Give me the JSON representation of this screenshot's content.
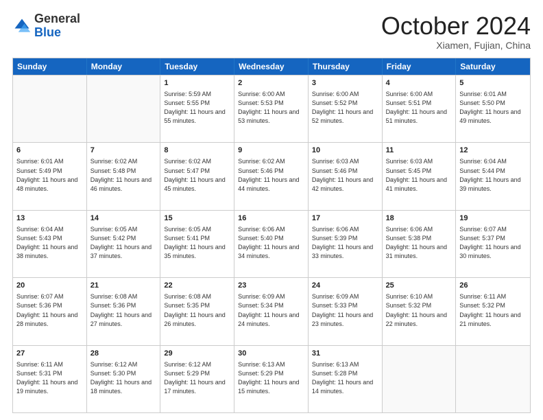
{
  "header": {
    "logo": {
      "general": "General",
      "blue": "Blue"
    },
    "title": "October 2024",
    "location": "Xiamen, Fujian, China"
  },
  "weekdays": [
    "Sunday",
    "Monday",
    "Tuesday",
    "Wednesday",
    "Thursday",
    "Friday",
    "Saturday"
  ],
  "rows": [
    [
      {
        "day": "",
        "sunrise": "",
        "sunset": "",
        "daylight": ""
      },
      {
        "day": "",
        "sunrise": "",
        "sunset": "",
        "daylight": ""
      },
      {
        "day": "1",
        "sunrise": "Sunrise: 5:59 AM",
        "sunset": "Sunset: 5:55 PM",
        "daylight": "Daylight: 11 hours and 55 minutes."
      },
      {
        "day": "2",
        "sunrise": "Sunrise: 6:00 AM",
        "sunset": "Sunset: 5:53 PM",
        "daylight": "Daylight: 11 hours and 53 minutes."
      },
      {
        "day": "3",
        "sunrise": "Sunrise: 6:00 AM",
        "sunset": "Sunset: 5:52 PM",
        "daylight": "Daylight: 11 hours and 52 minutes."
      },
      {
        "day": "4",
        "sunrise": "Sunrise: 6:00 AM",
        "sunset": "Sunset: 5:51 PM",
        "daylight": "Daylight: 11 hours and 51 minutes."
      },
      {
        "day": "5",
        "sunrise": "Sunrise: 6:01 AM",
        "sunset": "Sunset: 5:50 PM",
        "daylight": "Daylight: 11 hours and 49 minutes."
      }
    ],
    [
      {
        "day": "6",
        "sunrise": "Sunrise: 6:01 AM",
        "sunset": "Sunset: 5:49 PM",
        "daylight": "Daylight: 11 hours and 48 minutes."
      },
      {
        "day": "7",
        "sunrise": "Sunrise: 6:02 AM",
        "sunset": "Sunset: 5:48 PM",
        "daylight": "Daylight: 11 hours and 46 minutes."
      },
      {
        "day": "8",
        "sunrise": "Sunrise: 6:02 AM",
        "sunset": "Sunset: 5:47 PM",
        "daylight": "Daylight: 11 hours and 45 minutes."
      },
      {
        "day": "9",
        "sunrise": "Sunrise: 6:02 AM",
        "sunset": "Sunset: 5:46 PM",
        "daylight": "Daylight: 11 hours and 44 minutes."
      },
      {
        "day": "10",
        "sunrise": "Sunrise: 6:03 AM",
        "sunset": "Sunset: 5:46 PM",
        "daylight": "Daylight: 11 hours and 42 minutes."
      },
      {
        "day": "11",
        "sunrise": "Sunrise: 6:03 AM",
        "sunset": "Sunset: 5:45 PM",
        "daylight": "Daylight: 11 hours and 41 minutes."
      },
      {
        "day": "12",
        "sunrise": "Sunrise: 6:04 AM",
        "sunset": "Sunset: 5:44 PM",
        "daylight": "Daylight: 11 hours and 39 minutes."
      }
    ],
    [
      {
        "day": "13",
        "sunrise": "Sunrise: 6:04 AM",
        "sunset": "Sunset: 5:43 PM",
        "daylight": "Daylight: 11 hours and 38 minutes."
      },
      {
        "day": "14",
        "sunrise": "Sunrise: 6:05 AM",
        "sunset": "Sunset: 5:42 PM",
        "daylight": "Daylight: 11 hours and 37 minutes."
      },
      {
        "day": "15",
        "sunrise": "Sunrise: 6:05 AM",
        "sunset": "Sunset: 5:41 PM",
        "daylight": "Daylight: 11 hours and 35 minutes."
      },
      {
        "day": "16",
        "sunrise": "Sunrise: 6:06 AM",
        "sunset": "Sunset: 5:40 PM",
        "daylight": "Daylight: 11 hours and 34 minutes."
      },
      {
        "day": "17",
        "sunrise": "Sunrise: 6:06 AM",
        "sunset": "Sunset: 5:39 PM",
        "daylight": "Daylight: 11 hours and 33 minutes."
      },
      {
        "day": "18",
        "sunrise": "Sunrise: 6:06 AM",
        "sunset": "Sunset: 5:38 PM",
        "daylight": "Daylight: 11 hours and 31 minutes."
      },
      {
        "day": "19",
        "sunrise": "Sunrise: 6:07 AM",
        "sunset": "Sunset: 5:37 PM",
        "daylight": "Daylight: 11 hours and 30 minutes."
      }
    ],
    [
      {
        "day": "20",
        "sunrise": "Sunrise: 6:07 AM",
        "sunset": "Sunset: 5:36 PM",
        "daylight": "Daylight: 11 hours and 28 minutes."
      },
      {
        "day": "21",
        "sunrise": "Sunrise: 6:08 AM",
        "sunset": "Sunset: 5:36 PM",
        "daylight": "Daylight: 11 hours and 27 minutes."
      },
      {
        "day": "22",
        "sunrise": "Sunrise: 6:08 AM",
        "sunset": "Sunset: 5:35 PM",
        "daylight": "Daylight: 11 hours and 26 minutes."
      },
      {
        "day": "23",
        "sunrise": "Sunrise: 6:09 AM",
        "sunset": "Sunset: 5:34 PM",
        "daylight": "Daylight: 11 hours and 24 minutes."
      },
      {
        "day": "24",
        "sunrise": "Sunrise: 6:09 AM",
        "sunset": "Sunset: 5:33 PM",
        "daylight": "Daylight: 11 hours and 23 minutes."
      },
      {
        "day": "25",
        "sunrise": "Sunrise: 6:10 AM",
        "sunset": "Sunset: 5:32 PM",
        "daylight": "Daylight: 11 hours and 22 minutes."
      },
      {
        "day": "26",
        "sunrise": "Sunrise: 6:11 AM",
        "sunset": "Sunset: 5:32 PM",
        "daylight": "Daylight: 11 hours and 21 minutes."
      }
    ],
    [
      {
        "day": "27",
        "sunrise": "Sunrise: 6:11 AM",
        "sunset": "Sunset: 5:31 PM",
        "daylight": "Daylight: 11 hours and 19 minutes."
      },
      {
        "day": "28",
        "sunrise": "Sunrise: 6:12 AM",
        "sunset": "Sunset: 5:30 PM",
        "daylight": "Daylight: 11 hours and 18 minutes."
      },
      {
        "day": "29",
        "sunrise": "Sunrise: 6:12 AM",
        "sunset": "Sunset: 5:29 PM",
        "daylight": "Daylight: 11 hours and 17 minutes."
      },
      {
        "day": "30",
        "sunrise": "Sunrise: 6:13 AM",
        "sunset": "Sunset: 5:29 PM",
        "daylight": "Daylight: 11 hours and 15 minutes."
      },
      {
        "day": "31",
        "sunrise": "Sunrise: 6:13 AM",
        "sunset": "Sunset: 5:28 PM",
        "daylight": "Daylight: 11 hours and 14 minutes."
      },
      {
        "day": "",
        "sunrise": "",
        "sunset": "",
        "daylight": ""
      },
      {
        "day": "",
        "sunrise": "",
        "sunset": "",
        "daylight": ""
      }
    ]
  ]
}
